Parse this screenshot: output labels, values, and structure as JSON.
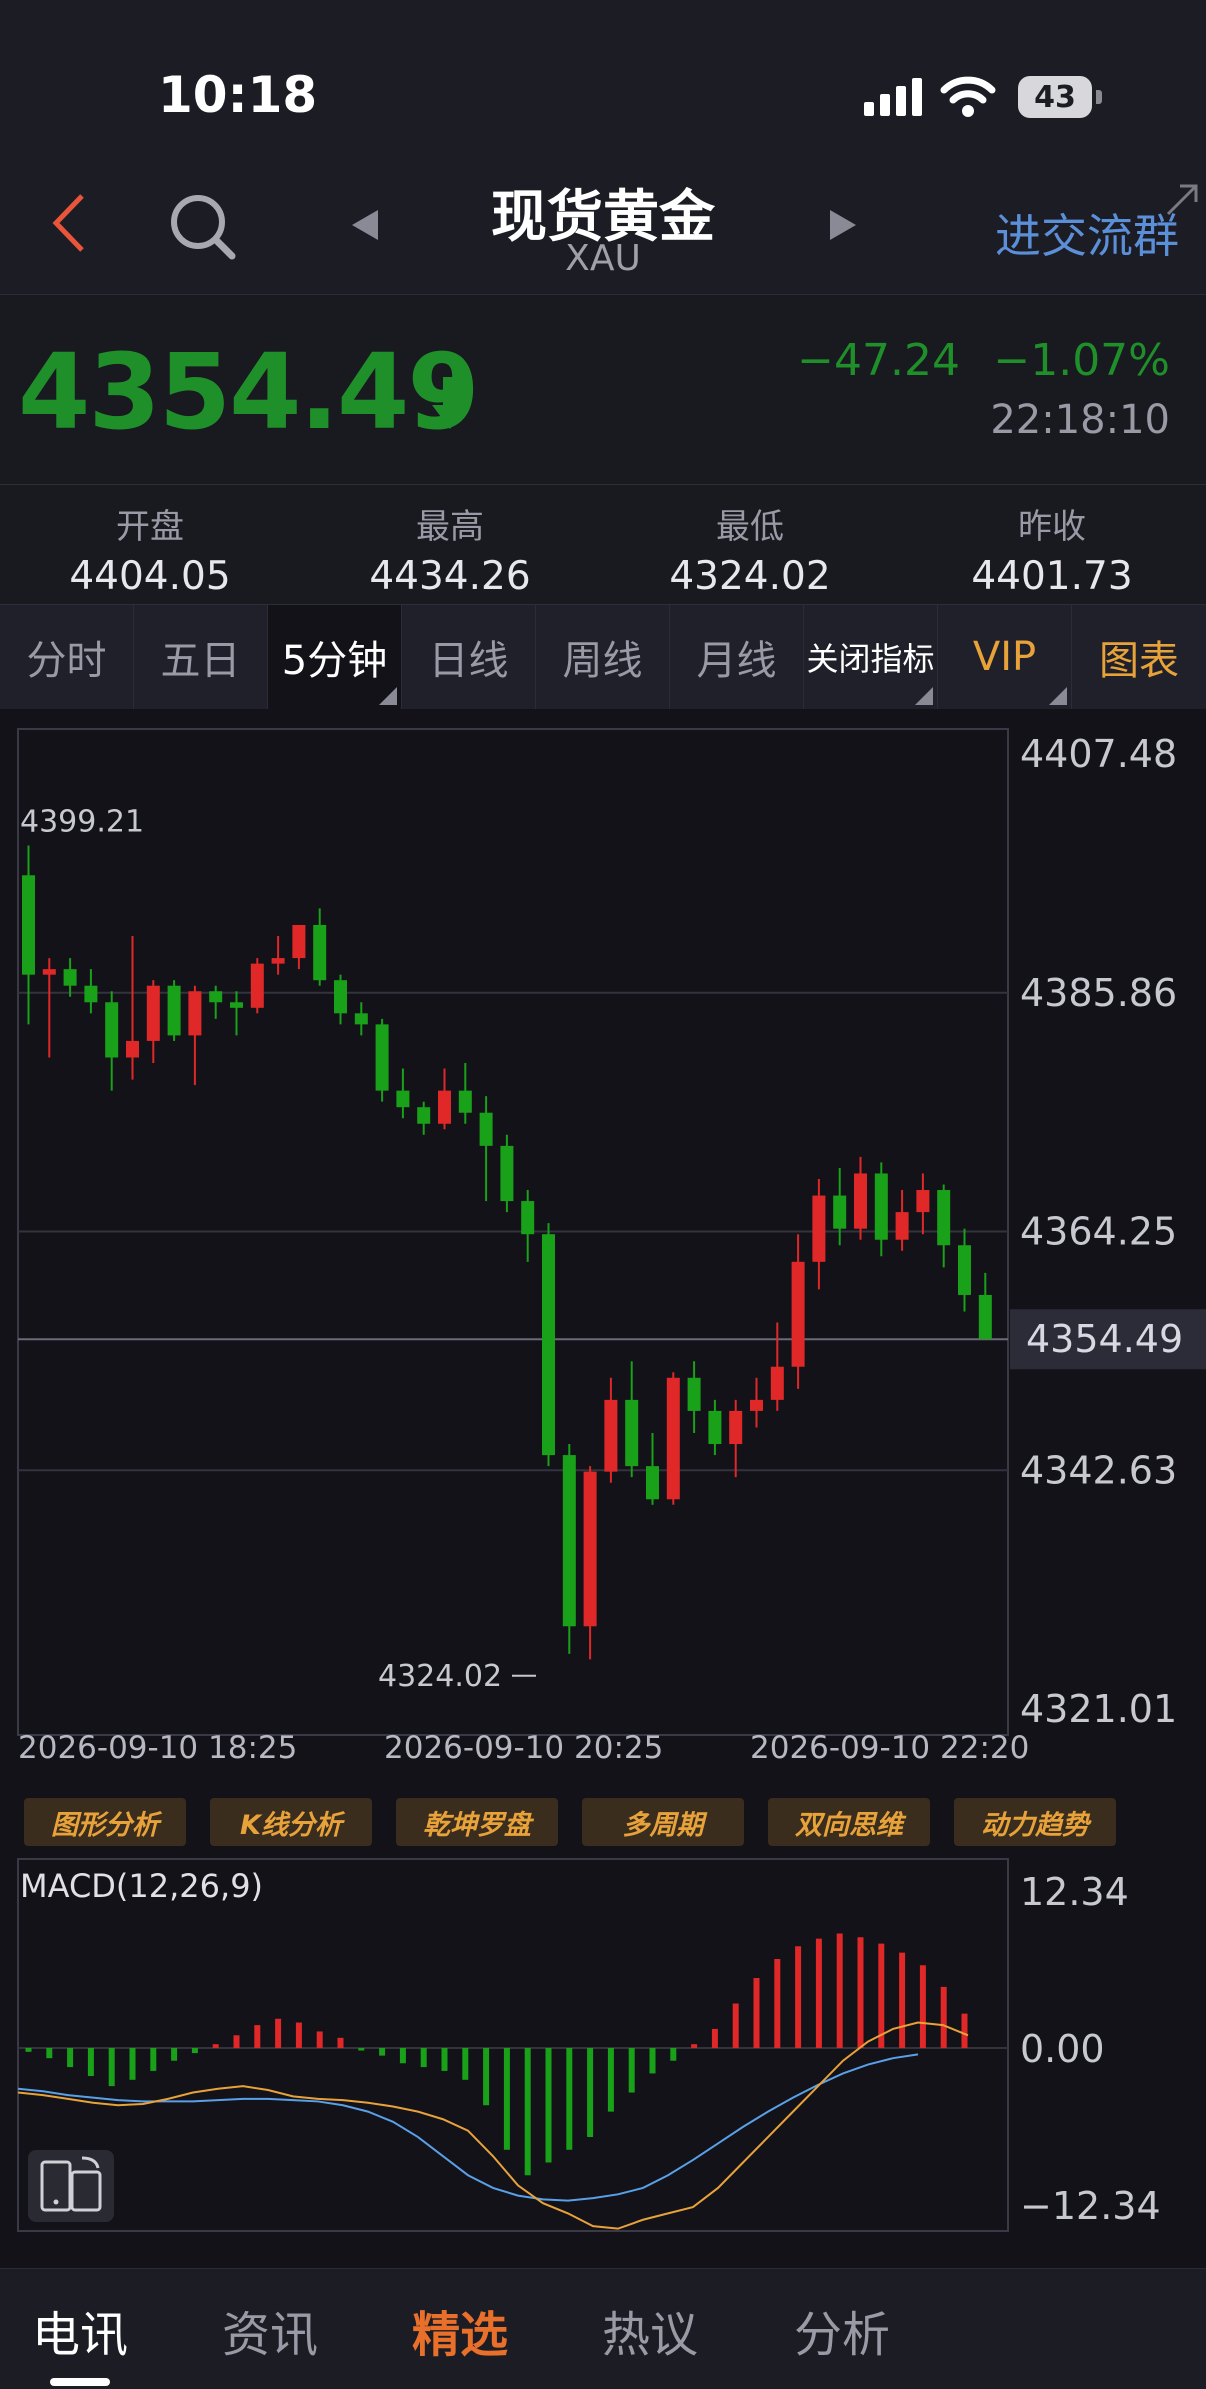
{
  "status_bar": {
    "time": "10:18",
    "battery": "43"
  },
  "nav": {
    "title": "现货黄金",
    "subtitle": "XAU",
    "join_group": "进交流群"
  },
  "quote": {
    "price": "4354.49",
    "change": "−47.24",
    "change_pct": "−1.07%",
    "time": "22:18:10"
  },
  "stats": [
    {
      "label": "开盘",
      "value": "4404.05"
    },
    {
      "label": "最高",
      "value": "4434.26"
    },
    {
      "label": "最低",
      "value": "4324.02"
    },
    {
      "label": "昨收",
      "value": "4401.73"
    }
  ],
  "tabs": [
    {
      "label": "分时"
    },
    {
      "label": "五日"
    },
    {
      "label": "5分钟"
    },
    {
      "label": "日线"
    },
    {
      "label": "周线"
    },
    {
      "label": "月线"
    },
    {
      "label": "关闭指标"
    },
    {
      "label": "VIP"
    },
    {
      "label": "图表"
    }
  ],
  "chart_data": [
    {
      "type": "candlestick",
      "y_ticks": [
        "4407.48",
        "4385.86",
        "4364.25",
        "4342.63",
        "4321.01"
      ],
      "ylim": [
        4321.01,
        4407.48
      ],
      "current_price_label": "4354.49",
      "current_price": 4354.49,
      "high_annotation": "4399.21",
      "high_value": 4399.21,
      "low_annotation": "4324.02",
      "low_value": 4324.02,
      "x_labels": [
        "2026-09-10 18:25",
        "2026-09-10 20:25",
        "2026-09-10 22:20"
      ],
      "candles": [
        [
          4396.5,
          4399.2,
          4383.0,
          4387.5
        ],
        [
          4387.5,
          4389.0,
          4380.0,
          4388.0
        ],
        [
          4388.0,
          4389.0,
          4385.5,
          4386.5
        ],
        [
          4386.5,
          4388.0,
          4384.0,
          4385.0
        ],
        [
          4385.0,
          4386.0,
          4377.0,
          4380.0
        ],
        [
          4380.0,
          4391.0,
          4378.0,
          4381.5
        ],
        [
          4381.5,
          4387.0,
          4379.5,
          4386.5
        ],
        [
          4386.5,
          4387.0,
          4381.5,
          4382.0
        ],
        [
          4382.0,
          4386.5,
          4377.5,
          4386.0
        ],
        [
          4386.0,
          4386.5,
          4383.5,
          4385.0
        ],
        [
          4385.0,
          4386.0,
          4382.0,
          4384.5
        ],
        [
          4384.5,
          4389.0,
          4384.0,
          4388.5
        ],
        [
          4388.5,
          4391.0,
          4387.5,
          4389.0
        ],
        [
          4389.0,
          4392.0,
          4388.0,
          4392.0
        ],
        [
          4392.0,
          4393.5,
          4386.5,
          4387.0
        ],
        [
          4387.0,
          4387.5,
          4383.0,
          4384.0
        ],
        [
          4384.0,
          4385.0,
          4382.0,
          4383.0
        ],
        [
          4383.0,
          4383.5,
          4376.0,
          4377.0
        ],
        [
          4377.0,
          4379.0,
          4374.5,
          4375.5
        ],
        [
          4375.5,
          4376.0,
          4373.0,
          4374.0
        ],
        [
          4374.0,
          4379.0,
          4373.5,
          4377.0
        ],
        [
          4377.0,
          4379.5,
          4374.0,
          4375.0
        ],
        [
          4375.0,
          4376.5,
          4367.0,
          4372.0
        ],
        [
          4372.0,
          4373.0,
          4366.0,
          4367.0
        ],
        [
          4367.0,
          4368.0,
          4361.5,
          4364.0
        ],
        [
          4364.0,
          4365.0,
          4343.0,
          4344.0
        ],
        [
          4344.0,
          4345.0,
          4326.0,
          4328.5
        ],
        [
          4328.5,
          4343.0,
          4325.5,
          4342.5
        ],
        [
          4342.5,
          4351.0,
          4341.5,
          4349.0
        ],
        [
          4349.0,
          4352.5,
          4342.0,
          4343.0
        ],
        [
          4343.0,
          4346.0,
          4339.5,
          4340.0
        ],
        [
          4340.0,
          4351.5,
          4339.5,
          4351.0
        ],
        [
          4351.0,
          4352.5,
          4346.0,
          4348.0
        ],
        [
          4348.0,
          4349.0,
          4344.0,
          4345.0
        ],
        [
          4345.0,
          4349.0,
          4342.0,
          4348.0
        ],
        [
          4348.0,
          4351.0,
          4346.5,
          4349.0
        ],
        [
          4349.0,
          4356.0,
          4348.0,
          4352.0
        ],
        [
          4352.0,
          4364.0,
          4350.0,
          4361.5
        ],
        [
          4361.5,
          4369.0,
          4359.0,
          4367.5
        ],
        [
          4367.5,
          4370.0,
          4363.0,
          4364.5
        ],
        [
          4364.5,
          4371.0,
          4363.5,
          4369.5
        ],
        [
          4369.5,
          4370.5,
          4362.0,
          4363.5
        ],
        [
          4363.5,
          4368.0,
          4362.5,
          4366.0
        ],
        [
          4366.0,
          4369.5,
          4364.0,
          4368.0
        ],
        [
          4368.0,
          4368.5,
          4361.0,
          4363.0
        ],
        [
          4363.0,
          4364.5,
          4357.0,
          4358.5
        ],
        [
          4358.5,
          4360.5,
          4354.5,
          4354.5
        ]
      ]
    },
    {
      "type": "bar",
      "title": "MACD(12,26,9)",
      "y_ticks": [
        "12.34",
        "0.00",
        "−12.34"
      ],
      "ylim": [
        -12.34,
        12.34
      ],
      "histogram": [
        -0.3,
        -0.8,
        -1.5,
        -2.2,
        -3.0,
        -2.5,
        -1.8,
        -1.0,
        -0.4,
        0.3,
        1.0,
        1.8,
        2.3,
        2.0,
        1.3,
        0.8,
        -0.2,
        -0.6,
        -1.2,
        -1.5,
        -1.8,
        -2.5,
        -4.5,
        -8.0,
        -10.0,
        -9.0,
        -8.0,
        -7.0,
        -5.0,
        -3.5,
        -2.0,
        -1.0,
        0.3,
        1.5,
        3.5,
        5.5,
        7.0,
        8.0,
        8.6,
        9.0,
        8.7,
        8.2,
        7.5,
        6.5,
        4.8,
        2.7
      ],
      "macd_line": [
        -3.5,
        -3.7,
        -4.0,
        -4.3,
        -4.5,
        -4.4,
        -4.0,
        -3.5,
        -3.2,
        -3.0,
        -3.3,
        -3.8,
        -4.0,
        -4.1,
        -4.3,
        -4.6,
        -5.0,
        -5.6,
        -6.5,
        -8.5,
        -10.8,
        -12.2,
        -13.0,
        -14.0,
        -14.2,
        -13.5,
        -13.0,
        -12.5,
        -11.0,
        -9.0,
        -7.0,
        -5.0,
        -3.0,
        -1.0,
        0.5,
        1.5,
        2.0,
        1.8,
        1.0
      ],
      "signal_line": [
        -3.2,
        -3.4,
        -3.7,
        -3.9,
        -4.1,
        -4.2,
        -4.2,
        -4.2,
        -4.1,
        -4.0,
        -4.0,
        -4.1,
        -4.2,
        -4.5,
        -5.0,
        -5.8,
        -7.0,
        -8.5,
        -10.0,
        -11.0,
        -11.6,
        -11.9,
        -12.0,
        -11.8,
        -11.5,
        -11.0,
        -10.0,
        -8.8,
        -7.5,
        -6.2,
        -5.0,
        -3.9,
        -2.9,
        -2.0,
        -1.3,
        -0.8,
        -0.5
      ]
    }
  ],
  "tools": [
    "图形分析",
    "K线分析",
    "乾坤罗盘",
    "多周期",
    "双向思维",
    "动力趋势"
  ],
  "bottom_nav": [
    {
      "label": "电讯"
    },
    {
      "label": "资讯"
    },
    {
      "label": "精选"
    },
    {
      "label": "热议"
    },
    {
      "label": "分析"
    }
  ],
  "colors": {
    "up": "#e02828",
    "down": "#1aa11a",
    "quote_down": "#1f8f2a",
    "accent_blue": "#5b8fd8",
    "accent_orange": "#e8702a",
    "vip_gold": "#e8a23a"
  }
}
